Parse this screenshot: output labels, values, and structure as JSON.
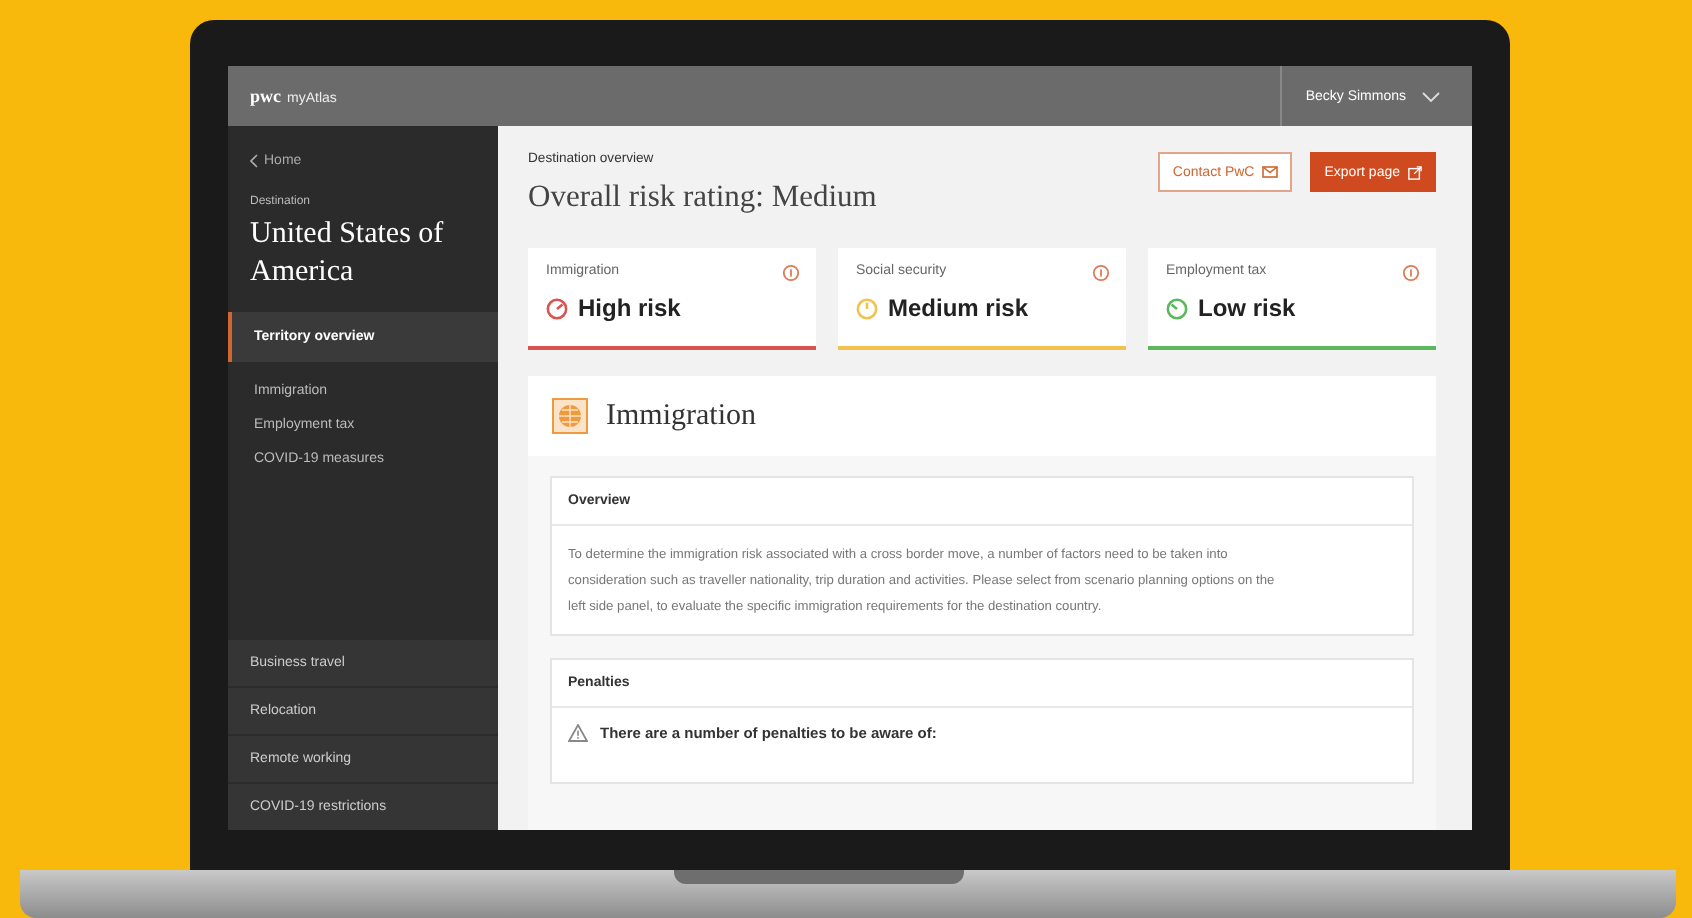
{
  "header": {
    "brand": "pwc",
    "product": "myAtlas",
    "user": "Becky Simmons"
  },
  "sidebar": {
    "back_link": "Home",
    "destination_label": "Destination",
    "destination": "United States of America",
    "items": [
      {
        "label": "Territory overview",
        "selected": true
      },
      {
        "label": "Immigration",
        "selected": false
      },
      {
        "label": "Employment tax",
        "selected": false
      },
      {
        "label": "COVID-19 measures",
        "selected": false
      }
    ],
    "bottom_items": [
      {
        "label": "Business travel"
      },
      {
        "label": "Relocation"
      },
      {
        "label": "Remote working"
      },
      {
        "label": "COVID-19 restrictions"
      }
    ]
  },
  "main": {
    "eyebrow": "Destination overview",
    "title": "Overall risk rating: Medium",
    "buttons": [
      {
        "label": "Contact PwC",
        "kind": "outline"
      },
      {
        "label": "Export page",
        "kind": "filled"
      }
    ],
    "risk_cards": [
      {
        "category": "Immigration",
        "rating": "High risk",
        "color": "#d9534f"
      },
      {
        "category": "Social security",
        "rating": "Medium risk",
        "color": "#f2c14e"
      },
      {
        "category": "Employment tax",
        "rating": "Low risk",
        "color": "#5cb85c"
      }
    ],
    "section": {
      "title": "Immigration",
      "panels": [
        {
          "heading": "Overview",
          "kind": "text",
          "body": "To determine the immigration risk associated with a cross border move, a number of factors need to be taken into consideration such as traveller nationality, trip duration and activities. Please select from scenario planning options on the left side panel, to evaluate the specific immigration requirements for the destination country."
        },
        {
          "heading": "Penalties",
          "kind": "warning",
          "body": "There are a number of penalties to be aware of:"
        }
      ]
    }
  }
}
